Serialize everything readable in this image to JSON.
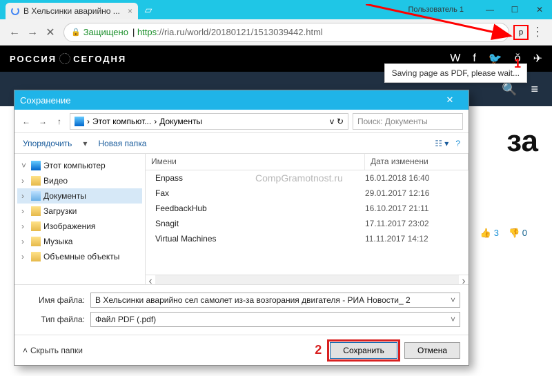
{
  "titlebar": {
    "tab_title": "В Хельсинки аварийно ...",
    "user_label": "Пользователь 1"
  },
  "address": {
    "secure_label": "Защищено",
    "scheme": "https",
    "rest": "://ria.ru/world/20180121/1513039442.html"
  },
  "markers": {
    "one": "1",
    "two": "2"
  },
  "site": {
    "brand1": "РОССИЯ",
    "brand2": "СЕГОДНЯ",
    "tooltip": "Saving page as PDF, please wait...",
    "headline_tail": "за",
    "reactions": {
      "up": "3",
      "down": "0"
    }
  },
  "dialog": {
    "title": "Сохранение",
    "breadcrumb": {
      "pc": "Этот компьют...",
      "folder": "Документы"
    },
    "search_placeholder": "Поиск: Документы",
    "toolbar": {
      "organize": "Упорядочить",
      "newfolder": "Новая папка"
    },
    "tree": {
      "root": "Этот компьютер",
      "items": [
        "Видео",
        "Документы",
        "Загрузки",
        "Изображения",
        "Музыка",
        "Объемные объекты"
      ]
    },
    "columns": {
      "name": "Имени",
      "date": "Дата изменени"
    },
    "files": [
      {
        "name": "Enpass",
        "date": "16.01.2018 16:40"
      },
      {
        "name": "Fax",
        "date": "29.01.2017 12:16"
      },
      {
        "name": "FeedbackHub",
        "date": "16.10.2017 21:11"
      },
      {
        "name": "Snagit",
        "date": "17.11.2017 23:02"
      },
      {
        "name": "Virtual Machines",
        "date": "11.11.2017 14:12"
      }
    ],
    "watermark": "CompGramotnost.ru",
    "fields": {
      "filename_label": "Имя файла:",
      "filename_value": "В Хельсинки аварийно сел самолет из-за возгорания двигателя - РИА Новости_ 2",
      "filetype_label": "Тип файла:",
      "filetype_value": "Файл PDF (.pdf)"
    },
    "footer": {
      "hide": "Скрыть папки",
      "save": "Сохранить",
      "cancel": "Отмена"
    }
  }
}
